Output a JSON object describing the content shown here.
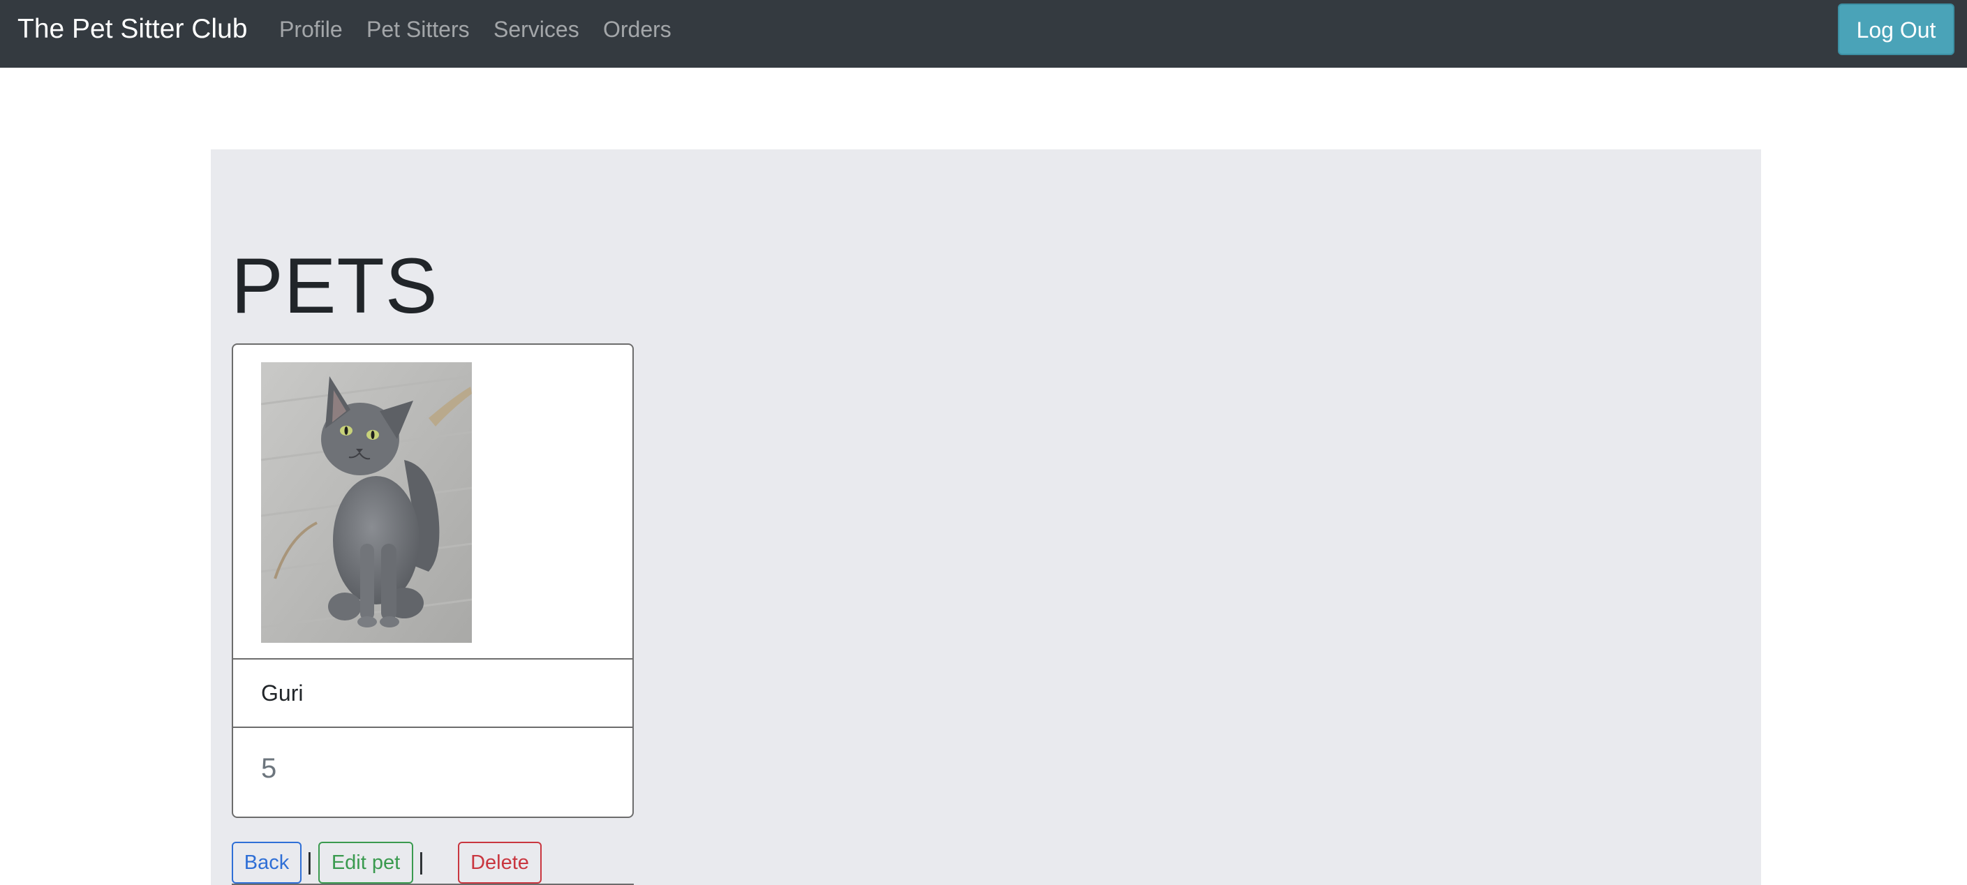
{
  "navbar": {
    "brand": "The Pet Sitter Club",
    "links": [
      "Profile",
      "Pet Sitters",
      "Services",
      "Orders"
    ],
    "logout_label": "Log Out"
  },
  "page": {
    "title": "PETS"
  },
  "pet_card": {
    "photo_alt": "Gray cat",
    "name": "Guri",
    "age": "5"
  },
  "actions": {
    "back_label": "Back",
    "edit_label": "Edit pet",
    "delete_label": "Delete",
    "separator": "|"
  },
  "colors": {
    "navbar_bg": "#343a40",
    "panel_bg": "#e9eaee",
    "logout_bg": "#4aa3b8",
    "back": "#2f6fd6",
    "edit": "#3a9a4f",
    "delete": "#c9363f"
  }
}
